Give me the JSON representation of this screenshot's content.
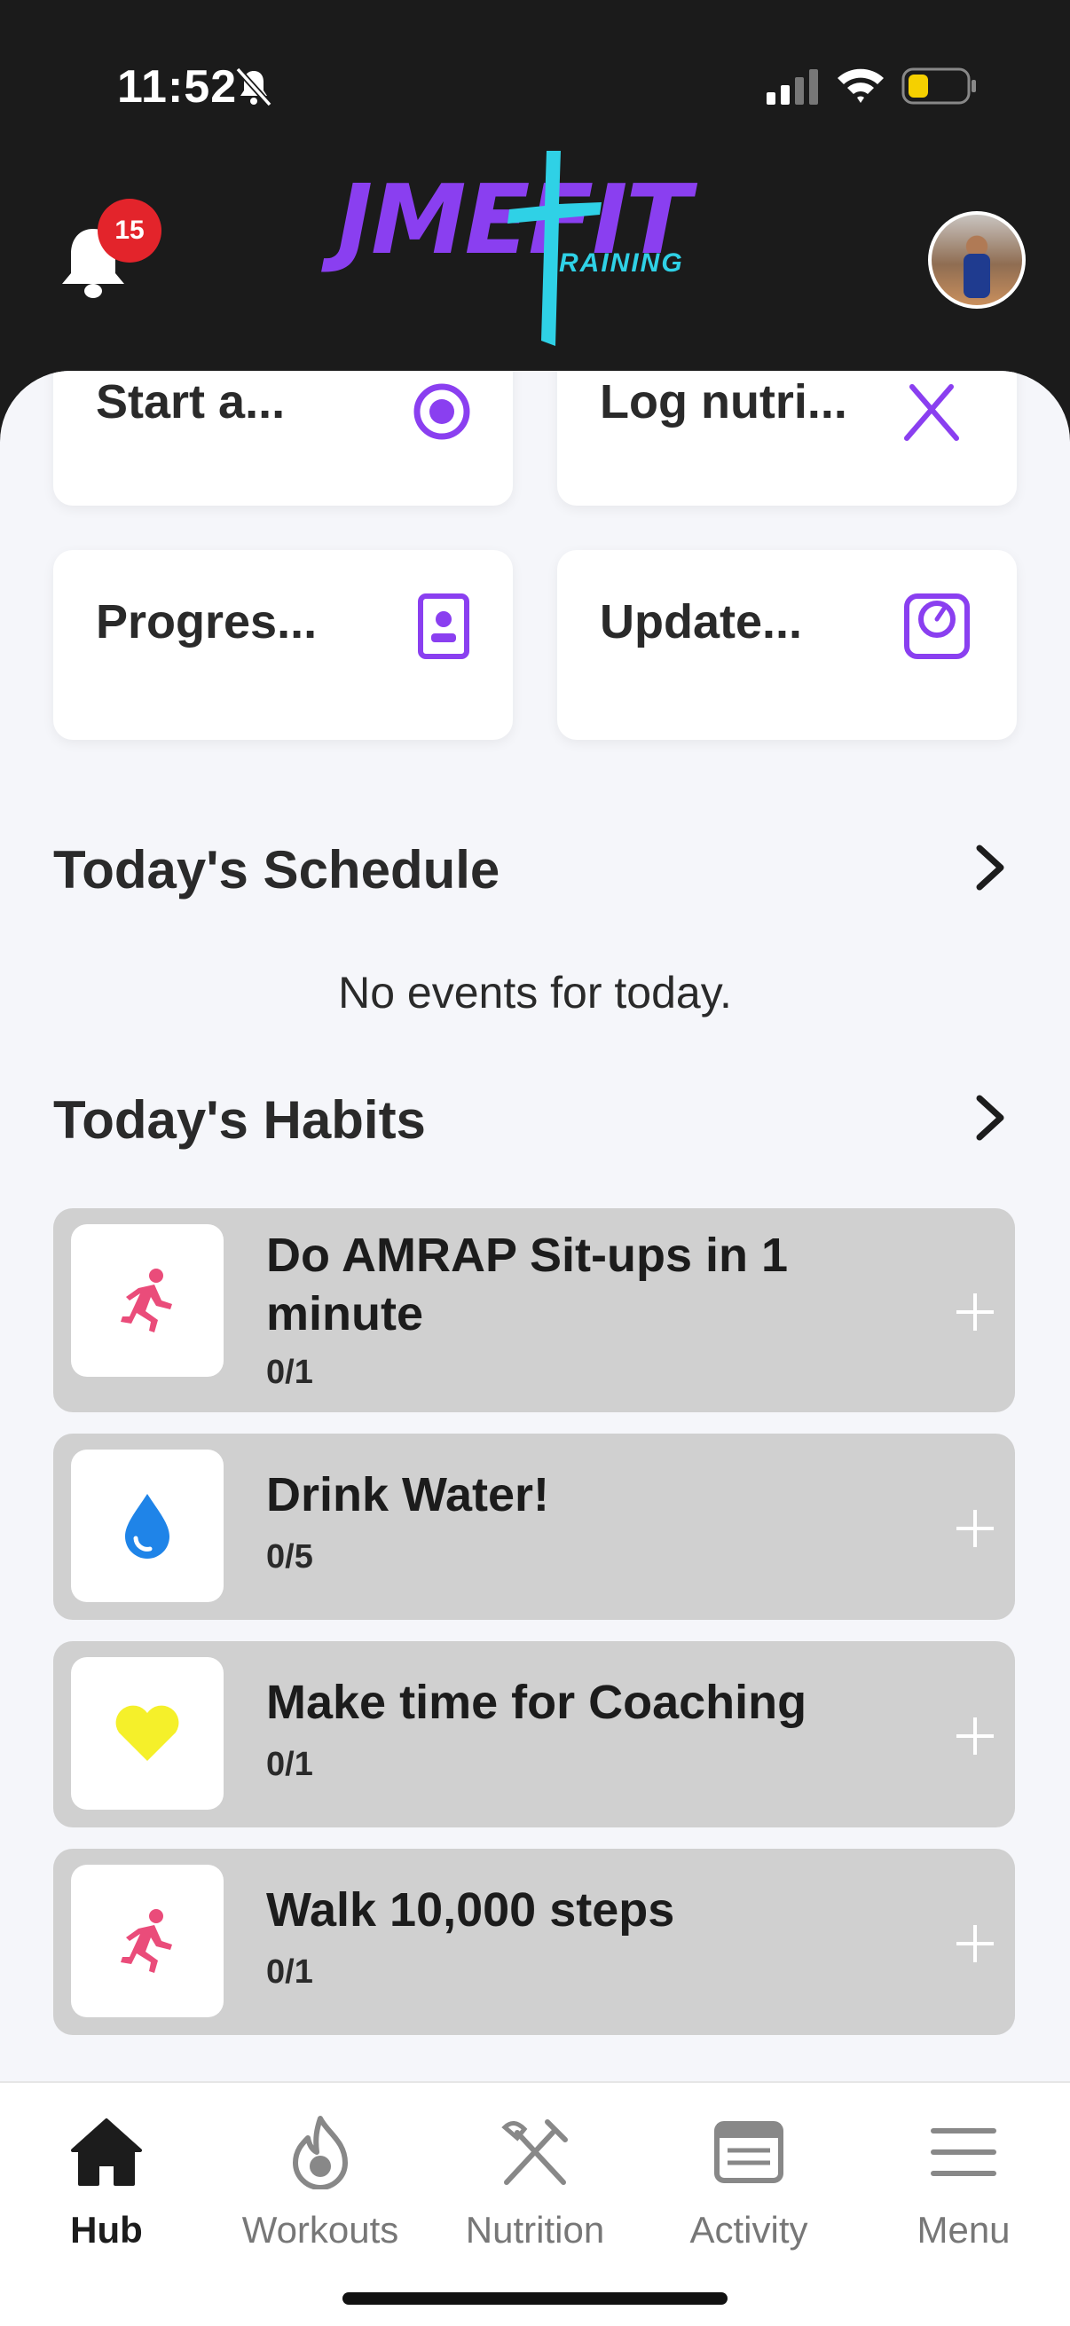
{
  "status_bar": {
    "time": "11:52"
  },
  "header": {
    "notification_count": "15",
    "logo_main": "JMEFIT",
    "logo_sub": "RAINING"
  },
  "quick_actions": [
    {
      "label": "Start a...",
      "icon": "target-icon"
    },
    {
      "label": "Log nutri...",
      "icon": "utensils-icon"
    },
    {
      "label": "Progres...",
      "icon": "badge-icon"
    },
    {
      "label": "Update...",
      "icon": "scale-icon"
    }
  ],
  "schedule": {
    "title": "Today's Schedule",
    "empty_text": "No events for today."
  },
  "habits": {
    "title": "Today's Habits",
    "items": [
      {
        "title": "Do AMRAP Sit-ups in 1 minute",
        "count": "0/1",
        "icon": "running-icon"
      },
      {
        "title": "Drink Water!",
        "count": "0/5",
        "icon": "water-drop-icon"
      },
      {
        "title": "Make time for Coaching",
        "count": "0/1",
        "icon": "heart-icon"
      },
      {
        "title": "Walk 10,000 steps",
        "count": "0/1",
        "icon": "running-icon"
      }
    ]
  },
  "tabbar": {
    "items": [
      {
        "label": "Hub",
        "icon": "home-icon",
        "active": true
      },
      {
        "label": "Workouts",
        "icon": "flame-icon",
        "active": false
      },
      {
        "label": "Nutrition",
        "icon": "utensils-icon",
        "active": false
      },
      {
        "label": "Activity",
        "icon": "calendar-card-icon",
        "active": false
      },
      {
        "label": "Menu",
        "icon": "hamburger-icon",
        "active": false
      }
    ]
  },
  "colors": {
    "accent_purple": "#8a3ff0",
    "logo_cyan": "#2fd1e6",
    "badge_red": "#e3242b",
    "habit_bg": "#d0d0d0",
    "running_pink": "#ea4c7a",
    "water_blue": "#1f84e8",
    "heart_yellow": "#f5f02a"
  }
}
